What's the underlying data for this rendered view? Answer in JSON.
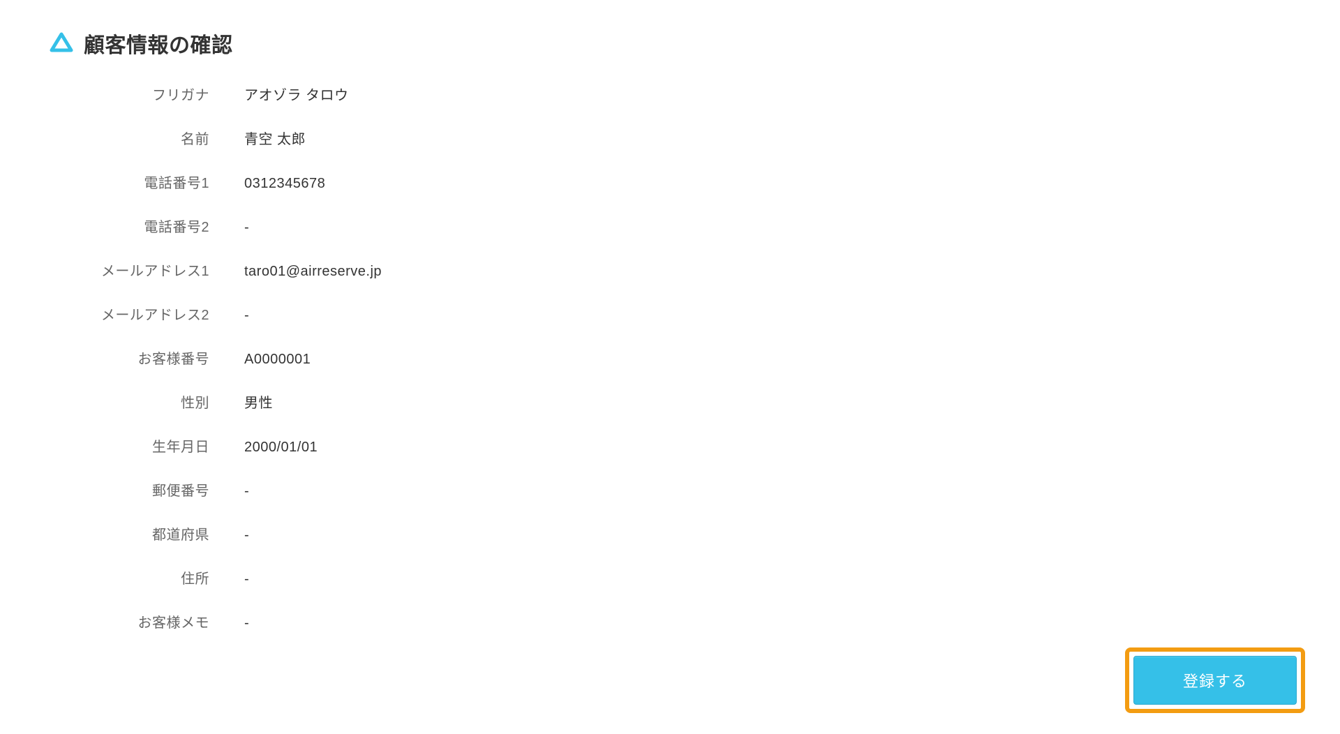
{
  "header": {
    "title": "顧客情報の確認"
  },
  "fields": {
    "furigana": {
      "label": "フリガナ",
      "value": "アオゾラ タロウ"
    },
    "name": {
      "label": "名前",
      "value": "青空 太郎"
    },
    "phone1": {
      "label": "電話番号1",
      "value": "0312345678"
    },
    "phone2": {
      "label": "電話番号2",
      "value": "-"
    },
    "email1": {
      "label": "メールアドレス1",
      "value": "taro01@airreserve.jp"
    },
    "email2": {
      "label": "メールアドレス2",
      "value": "-"
    },
    "customer_number": {
      "label": "お客様番号",
      "value": "A0000001"
    },
    "gender": {
      "label": "性別",
      "value": "男性"
    },
    "birthdate": {
      "label": "生年月日",
      "value": "2000/01/01"
    },
    "postal_code": {
      "label": "郵便番号",
      "value": "-"
    },
    "prefecture": {
      "label": "都道府県",
      "value": "-"
    },
    "address": {
      "label": "住所",
      "value": "-"
    },
    "customer_memo": {
      "label": "お客様メモ",
      "value": "-"
    }
  },
  "actions": {
    "register": "登録する"
  },
  "colors": {
    "accent": "#35c0e8",
    "highlight": "#f39c12"
  }
}
